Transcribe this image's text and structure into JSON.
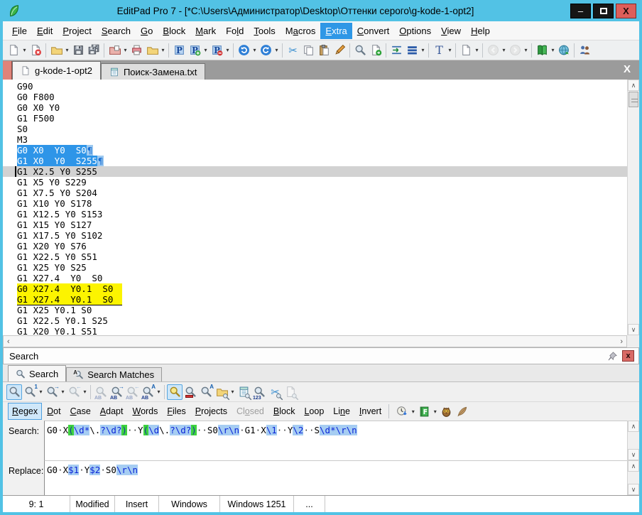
{
  "window": {
    "title": "EditPad Pro 7 - [*C:\\Users\\Администратор\\Desktop\\Оттенки серого\\g-kode-1-opt2]"
  },
  "menu": {
    "items": [
      {
        "label": "File",
        "u": 0
      },
      {
        "label": "Edit",
        "u": 0
      },
      {
        "label": "Project",
        "u": 0
      },
      {
        "label": "Search",
        "u": 0
      },
      {
        "label": "Go",
        "u": 0
      },
      {
        "label": "Block",
        "u": 0
      },
      {
        "label": "Mark",
        "u": 0
      },
      {
        "label": "Fold",
        "u": 2
      },
      {
        "label": "Tools",
        "u": 0
      },
      {
        "label": "Macros",
        "u": 1
      },
      {
        "label": "Extra",
        "u": 0,
        "active": true
      },
      {
        "label": "Convert",
        "u": 0
      },
      {
        "label": "Options",
        "u": 0
      },
      {
        "label": "View",
        "u": 0
      },
      {
        "label": "Help",
        "u": 0
      }
    ]
  },
  "tabs": [
    {
      "label": "g-kode-1-opt2",
      "active": true
    },
    {
      "label": "Поиск-Замена.txt",
      "active": false
    }
  ],
  "editor": {
    "pilcrow": "¶",
    "lines": [
      {
        "text": "G90"
      },
      {
        "text": "G0 F800"
      },
      {
        "text": "G0 X0 Y0"
      },
      {
        "text": "G1 F500"
      },
      {
        "text": "S0"
      },
      {
        "text": "M3"
      },
      {
        "text": "G0 X0  Y0  S0",
        "hl": "sel",
        "eol": true
      },
      {
        "text": "G1 X0  Y0  S255",
        "hl": "sel",
        "eol": true
      },
      {
        "text": "G1 X2.5 Y0 S255",
        "hl": "cur"
      },
      {
        "text": "G1 X5 Y0 S229"
      },
      {
        "text": "G1 X7.5 Y0 S204"
      },
      {
        "text": "G1 X10 Y0 S178"
      },
      {
        "text": "G1 X12.5 Y0 S153"
      },
      {
        "text": "G1 X15 Y0 S127"
      },
      {
        "text": "G1 X17.5 Y0 S102"
      },
      {
        "text": "G1 X20 Y0 S76"
      },
      {
        "text": "G1 X22.5 Y0 S51"
      },
      {
        "text": "G1 X25 Y0 S25"
      },
      {
        "text": "G1 X27.4  Y0  S0"
      },
      {
        "text": "G0 X27.4  Y0.1  S0",
        "hl": "mark"
      },
      {
        "text": "G1 X27.4  Y0.1  S0",
        "hl": "mark"
      },
      {
        "text": "G1 X25 Y0.1 S0"
      },
      {
        "text": "G1 X22.5 Y0.1 S25"
      },
      {
        "text": "G1 X20 Y0.1 S51"
      }
    ]
  },
  "search_panel": {
    "title": "Search",
    "tabs": [
      {
        "label": "Search",
        "active": true
      },
      {
        "label": "Search Matches",
        "active": false
      }
    ],
    "options": [
      {
        "label": "Regex",
        "u": 0,
        "state": "on"
      },
      {
        "label": "Dot",
        "u": 0,
        "state": "off"
      },
      {
        "label": "Case",
        "u": 0,
        "state": "off"
      },
      {
        "label": "Adapt",
        "u": 0,
        "state": "off"
      },
      {
        "label": "Words",
        "u": 0,
        "state": "off"
      },
      {
        "label": "Files",
        "u": 0,
        "state": "off"
      },
      {
        "label": "Projects",
        "u": 0,
        "state": "off"
      },
      {
        "label": "Closed",
        "u": 2,
        "state": "disabled"
      },
      {
        "label": "Block",
        "u": 0,
        "state": "off"
      },
      {
        "label": "Loop",
        "u": 0,
        "state": "off"
      },
      {
        "label": "Line",
        "u": 2,
        "state": "off"
      },
      {
        "label": "Invert",
        "u": 0,
        "state": "off"
      }
    ],
    "search_label": "Search:",
    "replace_label": "Replace:",
    "search_segments": [
      {
        "t": "G0",
        "c": "p"
      },
      {
        "t": "·",
        "c": "d"
      },
      {
        "t": "X",
        "c": "p"
      },
      {
        "t": "(",
        "c": "g"
      },
      {
        "t": "\\d*",
        "c": "b"
      },
      {
        "t": "\\.",
        "c": "p"
      },
      {
        "t": "?\\d?",
        "c": "b"
      },
      {
        "t": ")",
        "c": "g"
      },
      {
        "t": "··",
        "c": "d"
      },
      {
        "t": "Y",
        "c": "p"
      },
      {
        "t": "(",
        "c": "g"
      },
      {
        "t": "\\d",
        "c": "b"
      },
      {
        "t": "\\.",
        "c": "p"
      },
      {
        "t": "?\\d?",
        "c": "b"
      },
      {
        "t": ")",
        "c": "g"
      },
      {
        "t": "··",
        "c": "d"
      },
      {
        "t": "S0",
        "c": "p"
      },
      {
        "t": "\\r\\n",
        "c": "b"
      },
      {
        "t": "·",
        "c": "d"
      },
      {
        "t": "G1",
        "c": "p"
      },
      {
        "t": "·",
        "c": "d"
      },
      {
        "t": "X",
        "c": "p"
      },
      {
        "t": "\\1",
        "c": "b"
      },
      {
        "t": "··",
        "c": "d"
      },
      {
        "t": "Y",
        "c": "p"
      },
      {
        "t": "\\2",
        "c": "b"
      },
      {
        "t": "··",
        "c": "d"
      },
      {
        "t": "S",
        "c": "p"
      },
      {
        "t": "\\d*",
        "c": "b"
      },
      {
        "t": "\\r\\n",
        "c": "b"
      }
    ],
    "replace_segments": [
      {
        "t": "G0",
        "c": "p"
      },
      {
        "t": "·",
        "c": "d"
      },
      {
        "t": "X",
        "c": "p"
      },
      {
        "t": "$1",
        "c": "b"
      },
      {
        "t": "·",
        "c": "d"
      },
      {
        "t": "Y",
        "c": "p"
      },
      {
        "t": "$2",
        "c": "b"
      },
      {
        "t": "·",
        "c": "d"
      },
      {
        "t": "S0",
        "c": "p"
      },
      {
        "t": "\\r\\n",
        "c": "b"
      }
    ]
  },
  "status_bar": {
    "cells": [
      "9: 1",
      "Modified",
      "Insert",
      "Windows",
      "Windows 1251",
      "..."
    ]
  },
  "icons": {
    "dropdown": "▾",
    "up": "∧",
    "down": "∨",
    "left": "‹",
    "right": "›",
    "close": "X",
    "min": "–",
    "pin_close": "x",
    "p": "P",
    "t": "T",
    "one": "1",
    "a": "A",
    "ab": "AB",
    "num": "123",
    "f": "F",
    "arrow_r": "→",
    "arrow_l": "←"
  },
  "colors": {
    "frame": "#52c2e5",
    "menu_highlight": "#2f97e6",
    "selection": "#2e95e8",
    "mark_yellow": "#fcf400",
    "current_line": "#d2d2d2",
    "regex_token_bg": "#a6cdf2",
    "regex_group_bg": "#3ed23e"
  }
}
